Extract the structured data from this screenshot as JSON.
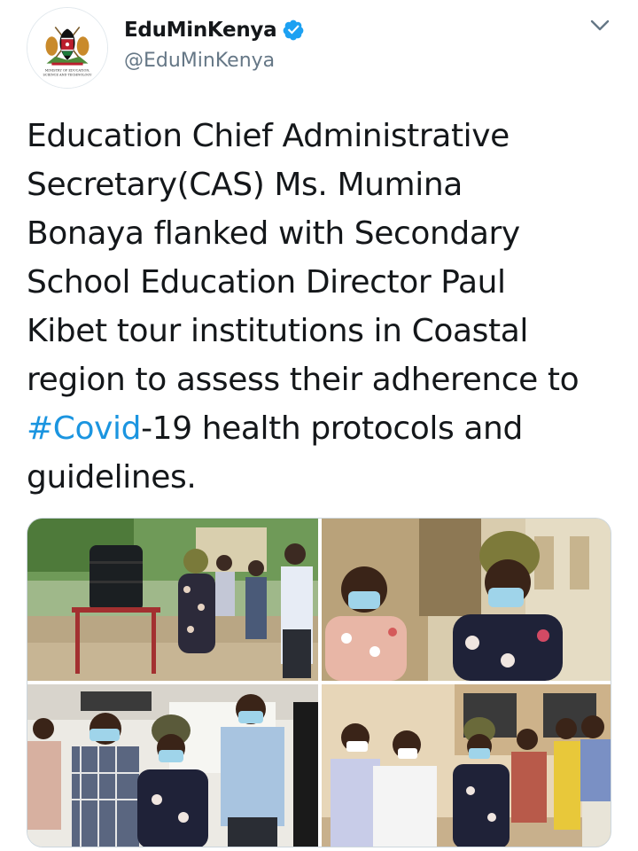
{
  "author": {
    "display_name": "EduMinKenya",
    "handle": "@EduMinKenya",
    "verified": true,
    "avatar_caption": "MINISTRY OF EDUCATION, SCIENCE AND TECHNOLOGY"
  },
  "tweet": {
    "lines": [
      "Education Chief Administrative",
      "Secretary(CAS) Ms. Mumina",
      "Bonaya flanked with Secondary",
      "School Education Director Paul",
      "Kibet tour institutions in Coastal",
      "region to assess their adherence to"
    ],
    "line7_hashtag": "#Covid",
    "line7_rest": "-19 health protocols and",
    "line8": "guidelines."
  },
  "media": {
    "photo_count": 4
  },
  "icons": {
    "verified": "verified-badge-icon",
    "menu": "chevron-down-icon"
  },
  "colors": {
    "text": "#14171a",
    "secondary": "#657786",
    "link": "#1b95e0",
    "verified": "#1da1f2"
  }
}
